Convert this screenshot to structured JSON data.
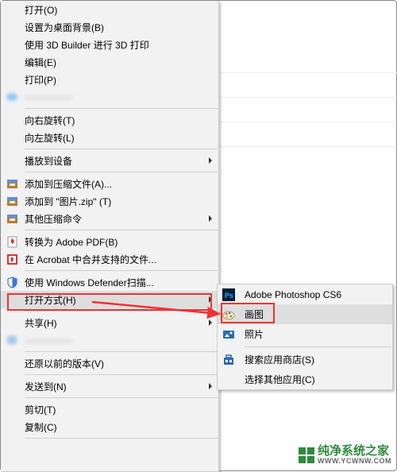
{
  "mainMenu": {
    "open": "打开(O)",
    "setWallpaper": "设置为桌面背景(B)",
    "print3d": "使用 3D Builder 进行 3D 打印",
    "edit": "编辑(E)",
    "print": "打印(P)",
    "blurred1": "—————",
    "rotateRight": "向右旋转(T)",
    "rotateLeft": "向左旋转(L)",
    "castToDevice": "播放到设备",
    "addToArchive": "添加到压缩文件(A)...",
    "addToZip": "添加到 \"图片.zip\" (T)",
    "otherZip": "其他压缩命令",
    "toPdf": "转换为 Adobe PDF(B)",
    "acrobatMerge": "在 Acrobat 中合并支持的文件...",
    "defender": "使用 Windows Defender扫描...",
    "openWith": "打开方式(H)",
    "share": "共享(H)",
    "blurred2": "—————",
    "restore": "还原以前的版本(V)",
    "sendTo": "发送到(N)",
    "cut": "剪切(T)",
    "copy": "复制(C)"
  },
  "subMenu": {
    "photoshop": "Adobe Photoshop CS6",
    "paint": "画图",
    "photos": "照片",
    "store": "搜索应用商店(S)",
    "chooseOther": "选择其他应用(C)"
  },
  "watermark": {
    "title": "纯净系统之家",
    "url": "WWW.YCWNW.COM"
  }
}
